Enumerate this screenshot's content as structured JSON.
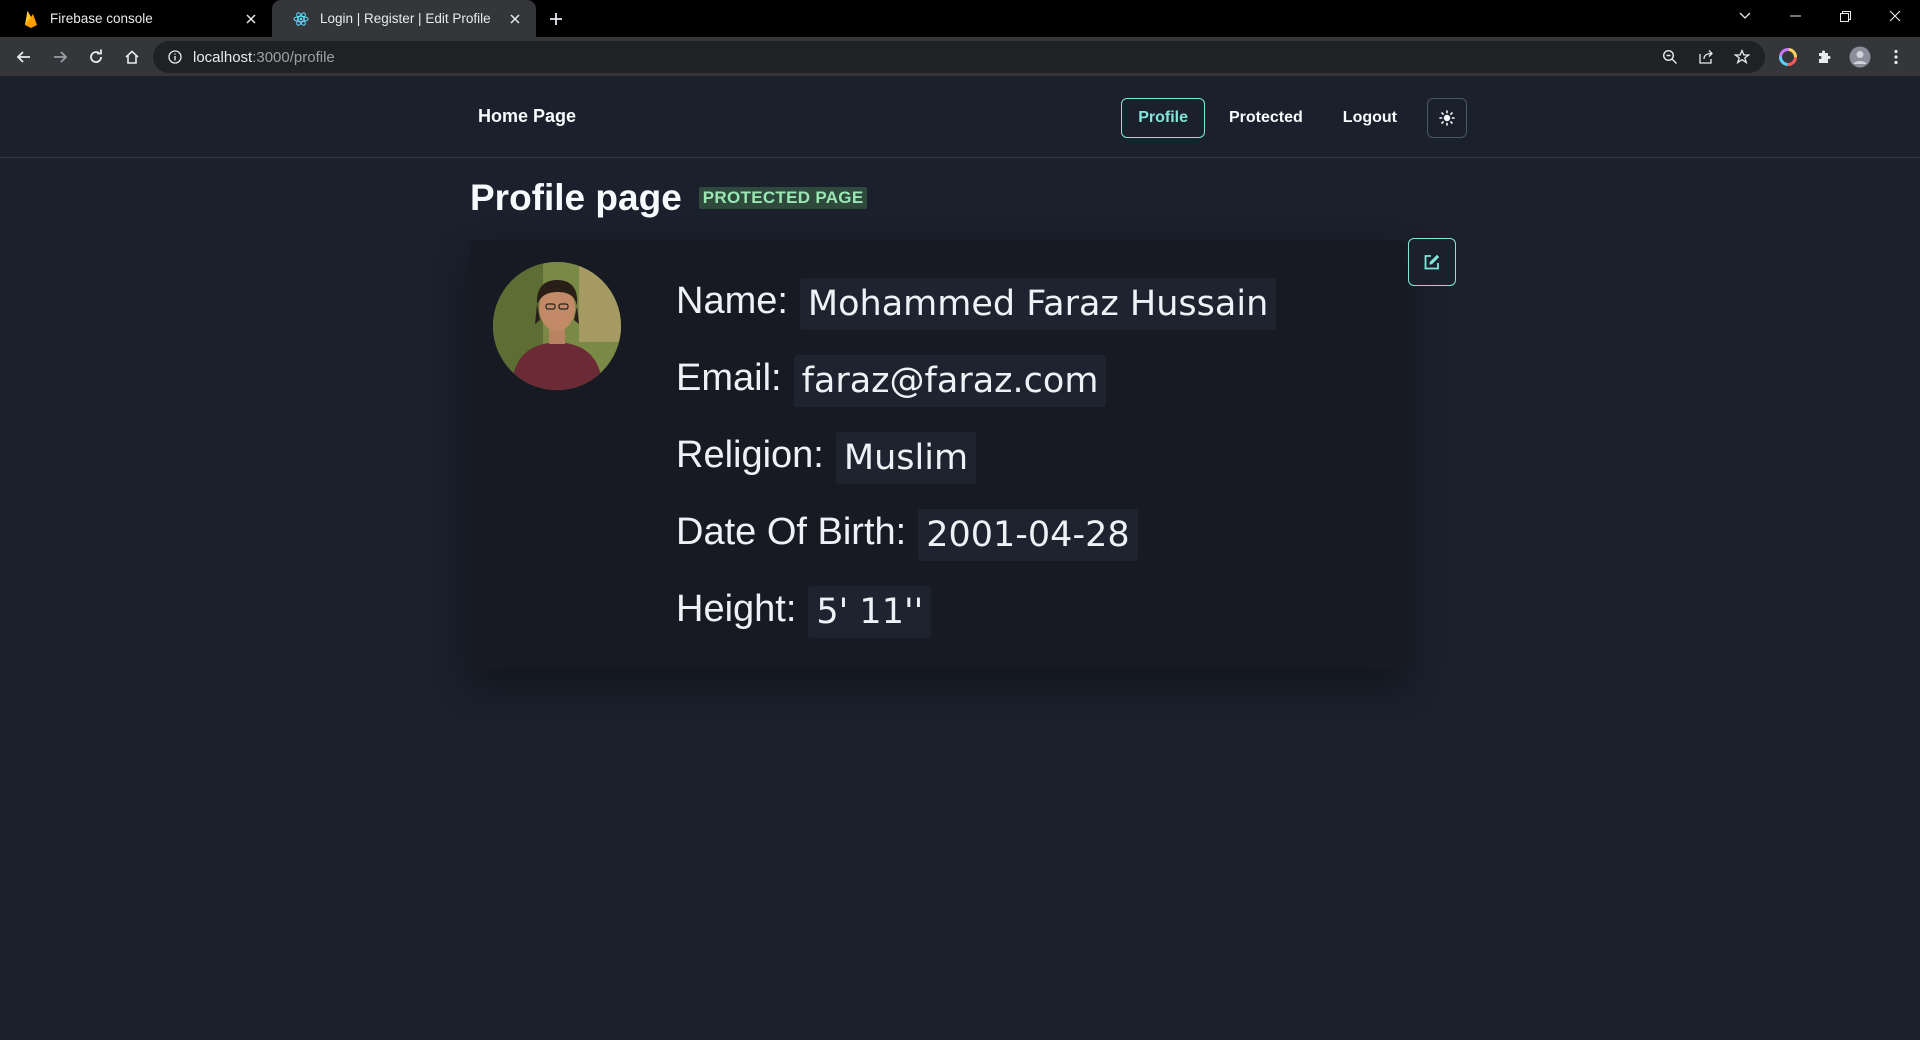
{
  "browser": {
    "tabs": [
      {
        "title": "Firebase console",
        "favicon": "firebase-flame-icon",
        "active": false
      },
      {
        "title": "Login | Register | Edit Profile",
        "favicon": "react-icon",
        "active": true
      }
    ],
    "url_host": "localhost",
    "url_path": ":3000/profile"
  },
  "nav": {
    "brand": "Home Page",
    "links": [
      "Profile",
      "Protected",
      "Logout"
    ],
    "accent": "#81e6d9"
  },
  "main": {
    "title": "Profile page",
    "badge": "PROTECTED PAGE",
    "fields": [
      {
        "label": "Name:",
        "value": "Mohammed Faraz Hussain"
      },
      {
        "label": "Email:",
        "value": "faraz@faraz.com"
      },
      {
        "label": "Religion:",
        "value": "Muslim"
      },
      {
        "label": "Date Of Birth:",
        "value": "2001-04-28"
      },
      {
        "label": "Height:",
        "value": "5' 11''"
      }
    ]
  }
}
